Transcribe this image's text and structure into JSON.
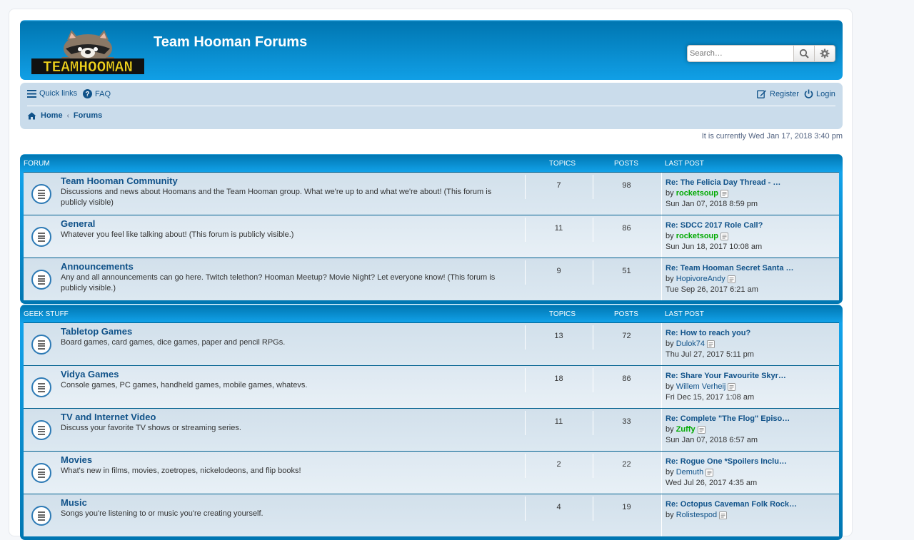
{
  "header": {
    "logo_text": "TEAMHOOMAN",
    "site_title": "Team Hooman Forums",
    "search_placeholder": "Search…"
  },
  "nav": {
    "quick_links": "Quick links",
    "faq": "FAQ",
    "register": "Register",
    "login": "Login",
    "crumb_home": "Home",
    "crumb_forums": "Forums"
  },
  "time_text": "It is currently Wed Jan 17, 2018 3:40 pm",
  "categories": [
    {
      "title": "Forum",
      "col_topics": "Topics",
      "col_posts": "Posts",
      "col_last": "Last post",
      "forums": [
        {
          "name": "Team Hooman Community",
          "desc": "Discussions and news about Hoomans and the Team Hooman group. What we're up to and what we're about! (This forum is publicly visible)",
          "topics": "7",
          "posts": "98",
          "last_title": "Re: The Felicia Day Thread - …",
          "last_by": "by",
          "last_user": "rocketsoup",
          "last_user_color": "green",
          "last_time": "Sun Jan 07, 2018 8:59 pm"
        },
        {
          "name": "General",
          "desc": "Whatever you feel like talking about! (This forum is publicly visible.)",
          "topics": "11",
          "posts": "86",
          "last_title": "Re: SDCC 2017 Role Call?",
          "last_by": "by",
          "last_user": "rocketsoup",
          "last_user_color": "green",
          "last_time": "Sun Jun 18, 2017 10:08 am"
        },
        {
          "name": "Announcements",
          "desc": "Any and all announcements can go here. Twitch telethon? Hooman Meetup? Movie Night? Let everyone know! (This forum is publicly visible.)",
          "topics": "9",
          "posts": "51",
          "last_title": "Re: Team Hooman Secret Santa …",
          "last_by": "by",
          "last_user": "HopivoreAndy",
          "last_user_color": "blue",
          "last_time": "Tue Sep 26, 2017 6:21 am"
        }
      ]
    },
    {
      "title": "Geek Stuff",
      "col_topics": "Topics",
      "col_posts": "Posts",
      "col_last": "Last post",
      "forums": [
        {
          "name": "Tabletop Games",
          "desc": "Board games, card games, dice games, paper and pencil RPGs.",
          "topics": "13",
          "posts": "72",
          "last_title": "Re: How to reach you?",
          "last_by": "by",
          "last_user": "Dulok74",
          "last_user_color": "blue",
          "last_time": "Thu Jul 27, 2017 5:11 pm"
        },
        {
          "name": "Vidya Games",
          "desc": "Console games, PC games, handheld games, mobile games, whatevs.",
          "topics": "18",
          "posts": "86",
          "last_title": "Re: Share Your Favourite Skyr…",
          "last_by": "by",
          "last_user": "Willem Verheij",
          "last_user_color": "blue",
          "last_time": "Fri Dec 15, 2017 1:08 am"
        },
        {
          "name": "TV and Internet Video",
          "desc": "Discuss your favorite TV shows or streaming series.",
          "topics": "11",
          "posts": "33",
          "last_title": "Re: Complete \"The Flog\" Episo…",
          "last_by": "by",
          "last_user": "Zuffy",
          "last_user_color": "green",
          "last_time": "Sun Jan 07, 2018 6:57 am"
        },
        {
          "name": "Movies",
          "desc": "What's new in films, movies, zoetropes, nickelodeons, and flip books!",
          "topics": "2",
          "posts": "22",
          "last_title": "Re: Rogue One *Spoilers Inclu…",
          "last_by": "by",
          "last_user": "Demuth",
          "last_user_color": "blue",
          "last_time": "Wed Jul 26, 2017 4:35 am"
        },
        {
          "name": "Music",
          "desc": "Songs you're listening to or music you're creating yourself.",
          "topics": "4",
          "posts": "19",
          "last_title": "Re: Octopus Caveman Folk Rock…",
          "last_by": "by",
          "last_user": "Rolistespod",
          "last_user_color": "blue",
          "last_time": ""
        }
      ]
    }
  ]
}
